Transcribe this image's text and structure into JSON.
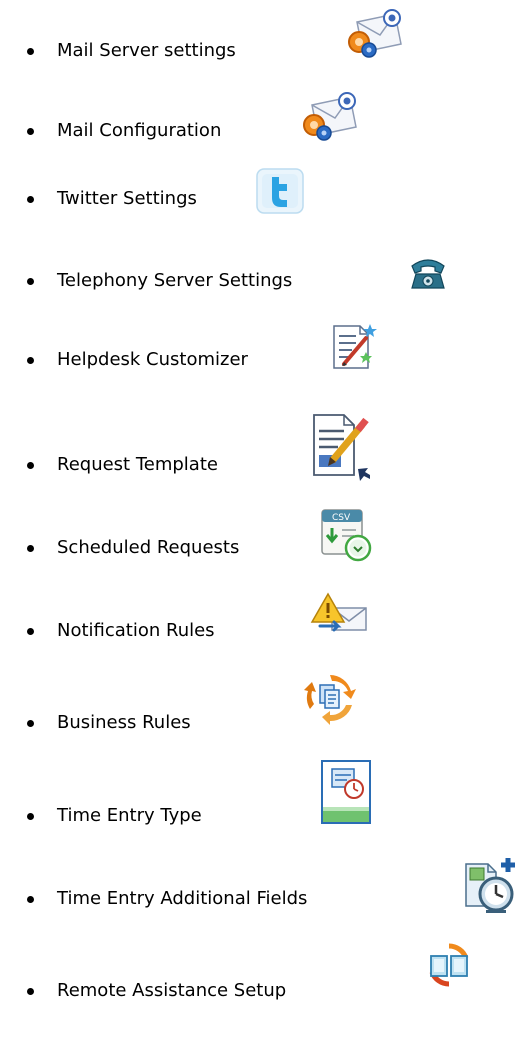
{
  "items": [
    {
      "label": "Mail Server settings",
      "icon": "mail-server-gear-icon"
    },
    {
      "label": "Mail Configuration",
      "icon": "mail-config-gear-icon"
    },
    {
      "label": "Twitter Settings",
      "icon": "twitter-icon"
    },
    {
      "label": "Telephony Server Settings",
      "icon": "telephone-icon"
    },
    {
      "label": "Helpdesk Customizer",
      "icon": "customizer-icon"
    },
    {
      "label": "Request Template",
      "icon": "document-edit-icon"
    },
    {
      "label": "Scheduled Requests",
      "icon": "scheduled-csv-icon"
    },
    {
      "label": "Notification Rules",
      "icon": "notification-warning-mail-icon"
    },
    {
      "label": "Business Rules",
      "icon": "business-rules-cycle-icon"
    },
    {
      "label": "Time Entry Type",
      "icon": "time-entry-type-icon"
    },
    {
      "label": "Time Entry Additional Fields",
      "icon": "time-entry-fields-icon"
    },
    {
      "label": "Remote Assistance Setup",
      "icon": "remote-assistance-icon"
    }
  ]
}
